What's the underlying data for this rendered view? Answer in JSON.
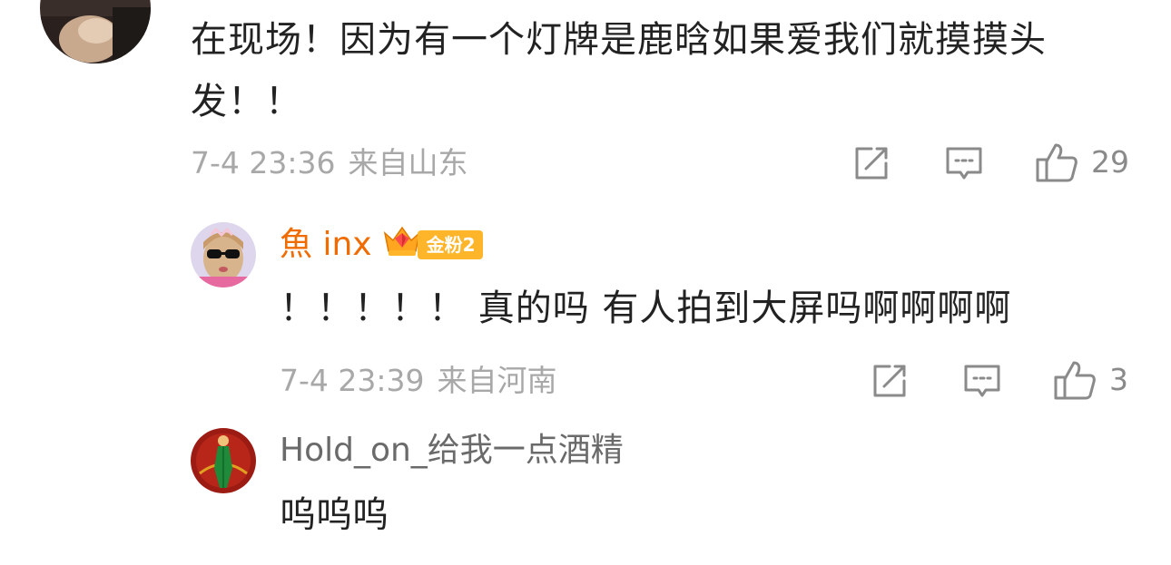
{
  "comments": [
    {
      "text": "在现场！因为有一个灯牌是鹿晗如果爱我们就摸摸头发！！",
      "time": "7-4 23:36",
      "location": "来自山东",
      "like_count": "29",
      "avatar_icon": "user-avatar-photo"
    },
    {
      "username": "魚 inx",
      "username_color": "#f06b00",
      "badge_label": "金粉2",
      "badge_color": "#ffb52a",
      "text": "！！！！！ 真的吗 有人拍到大屏吗啊啊啊啊",
      "time": "7-4 23:39",
      "location": "来自河南",
      "like_count": "3",
      "avatar_icon": "user-avatar-photo"
    },
    {
      "username": "Hold_on_给我一点酒精",
      "text": "呜呜呜",
      "avatar_icon": "user-avatar-illustration"
    }
  ],
  "icons": {
    "share": "share-icon",
    "reply": "comment-icon",
    "like": "thumbs-up-icon",
    "badge": "crown-diamond-icon"
  }
}
